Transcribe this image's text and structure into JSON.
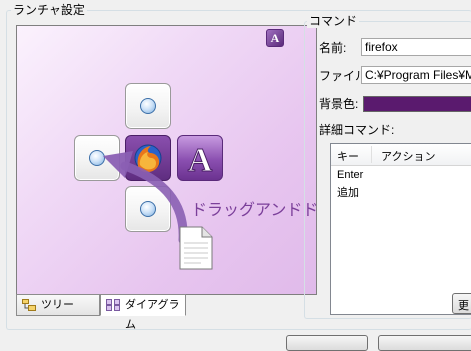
{
  "launcher_group": {
    "title": "ランチャ設定"
  },
  "diagram": {
    "hint_text": "ドラッグアンドドロップ",
    "corner_badge": "A",
    "apps": [
      {
        "name": "firefox",
        "icon": "firefox-icon"
      },
      {
        "name": "A",
        "icon": "purple-a-app-icon"
      }
    ]
  },
  "tabs": [
    {
      "label": "ツリー",
      "icon": "tree-icon",
      "active": false
    },
    {
      "label": "ダイアグラム",
      "icon": "diagram-icon",
      "active": true
    }
  ],
  "command_group": {
    "title": "コマンド",
    "name_label": "名前:",
    "name_value": "firefox",
    "file_label": "ファイル:",
    "file_value": "C:¥Program Files¥Mo",
    "bg_label": "背景色:",
    "bg_color": "#5a1a6e",
    "detail_label": "詳細コマンド:",
    "columns": [
      "キー",
      "アクション"
    ],
    "rows": [
      {
        "key": "Enter",
        "action": ""
      },
      {
        "key": "追加",
        "action": ""
      }
    ],
    "side_button": "更"
  },
  "colors": {
    "accent_purple": "#7b3f9a",
    "arrow_purple": "#8a5fb3"
  }
}
